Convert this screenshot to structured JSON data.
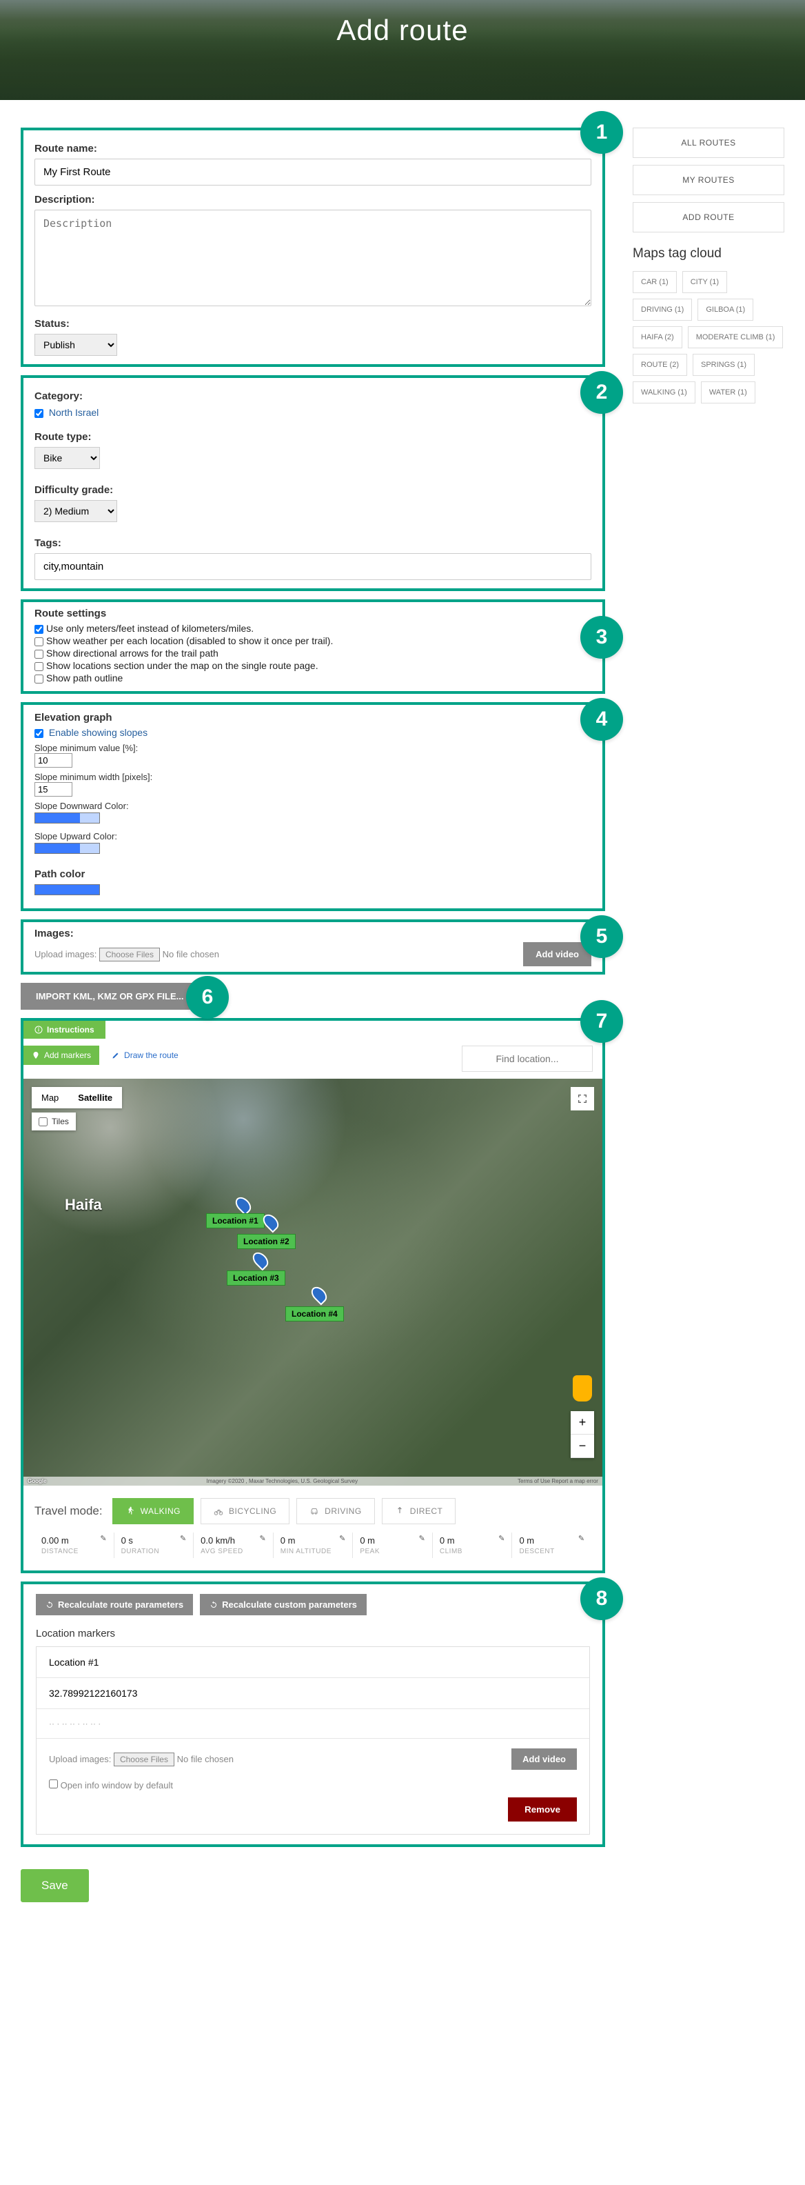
{
  "hero": {
    "title": "Add route"
  },
  "sidebar": {
    "buttons": [
      {
        "label": "ALL ROUTES"
      },
      {
        "label": "MY ROUTES"
      },
      {
        "label": "ADD ROUTE"
      }
    ],
    "tag_cloud_title": "Maps tag cloud",
    "tags": [
      "CAR (1)",
      "CITY (1)",
      "DRIVING (1)",
      "GILBOA (1)",
      "HAIFA (2)",
      "MODERATE CLIMB (1)",
      "ROUTE (2)",
      "SPRINGS (1)",
      "WALKING (1)",
      "WATER (1)"
    ]
  },
  "box1": {
    "route_name_label": "Route name:",
    "route_name_value": "My First Route",
    "description_label": "Description:",
    "description_placeholder": "Description",
    "status_label": "Status:",
    "status_value": "Publish"
  },
  "box2": {
    "category_label": "Category:",
    "category_option": "North Israel",
    "route_type_label": "Route type:",
    "route_type_value": "Bike",
    "difficulty_label": "Difficulty grade:",
    "difficulty_value": "2) Medium",
    "tags_label": "Tags:",
    "tags_value": "city,mountain"
  },
  "box3": {
    "title": "Route settings",
    "options": [
      {
        "checked": true,
        "label": "Use only meters/feet instead of kilometers/miles."
      },
      {
        "checked": false,
        "label": "Show weather per each location (disabled to show it once per trail)."
      },
      {
        "checked": false,
        "label": "Show directional arrows for the trail path"
      },
      {
        "checked": false,
        "label": "Show locations section under the map on the single route page."
      },
      {
        "checked": false,
        "label": "Show path outline"
      }
    ]
  },
  "box4": {
    "title": "Elevation graph",
    "enable_label": "Enable showing slopes",
    "slope_min_val_label": "Slope minimum value [%]:",
    "slope_min_val": "10",
    "slope_min_width_label": "Slope minimum width [pixels]:",
    "slope_min_width": "15",
    "down_color_label": "Slope Downward Color:",
    "up_color_label": "Slope Upward Color:",
    "path_color_label": "Path color"
  },
  "box5": {
    "images_label": "Images:",
    "upload_label": "Upload images:",
    "choose_files": "Choose Files",
    "no_file": "No file chosen",
    "add_video": "Add video"
  },
  "box6": {
    "import_label": "IMPORT KML, KMZ OR GPX FILE..."
  },
  "box7": {
    "instructions": "Instructions",
    "add_markers": "Add markers",
    "draw_route": "Draw the route",
    "find_placeholder": "Find location...",
    "map_btn": "Map",
    "sat_btn": "Satellite",
    "tiles": "Tiles",
    "haifa": "Haifa",
    "locations": [
      "Location #1",
      "Location #2",
      "Location #3",
      "Location #4"
    ],
    "google": "Google",
    "attrib_right": "Terms of Use   Report a map error",
    "attrib_mid": "Imagery ©2020 , Maxar Technologies, U.S. Geological Survey",
    "travel_label": "Travel mode:",
    "travel_modes": [
      {
        "label": "WALKING",
        "active": true
      },
      {
        "label": "BICYCLING",
        "active": false
      },
      {
        "label": "DRIVING",
        "active": false
      },
      {
        "label": "DIRECT",
        "active": false
      }
    ],
    "stats": [
      {
        "val": "0.00 m",
        "lbl": "DISTANCE"
      },
      {
        "val": "0 s",
        "lbl": "DURATION"
      },
      {
        "val": "0.0 km/h",
        "lbl": "AVG SPEED"
      },
      {
        "val": "0 m",
        "lbl": "MIN ALTITUDE"
      },
      {
        "val": "0 m",
        "lbl": "PEAK"
      },
      {
        "val": "0 m",
        "lbl": "CLIMB"
      },
      {
        "val": "0 m",
        "lbl": "DESCENT"
      }
    ]
  },
  "box8": {
    "recalc_route": "Recalculate route parameters",
    "recalc_custom": "Recalculate custom parameters",
    "loc_markers_title": "Location markers",
    "loc1_name": "Location #1",
    "loc1_lat": "32.78992122160173",
    "upload_label": "Upload images:",
    "choose_files": "Choose Files",
    "no_file": "No file chosen",
    "add_video": "Add video",
    "open_info": "Open info window by default",
    "remove": "Remove"
  },
  "save": "Save"
}
